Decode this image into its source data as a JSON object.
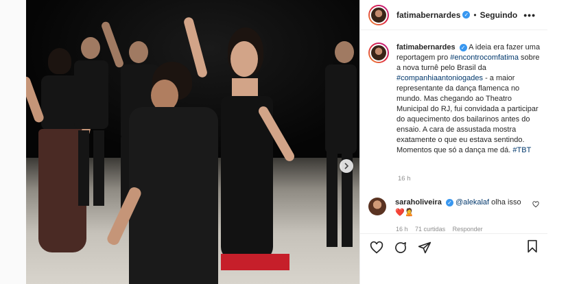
{
  "header": {
    "username": "fatimabernardes",
    "separator": "•",
    "follow_status": "Seguindo",
    "more": "•••"
  },
  "caption": {
    "username": "fatimabernardes",
    "text_part1": "A ideia era fazer uma reportagem pro",
    "hashtag1": "#encontrocomfatima",
    "text_part2": "sobre a nova turnê pelo Brasil da",
    "mention1": "#companhiaantoniogades",
    "text_part3": "- a maior representante da dança flamenca no mundo. Mas chegando ao Theatro Municipal do RJ, fui convidada a participar do aquecimento dos bailarinos antes do ensaio. A cara de assustada mostra exatamente o que eu estava sentindo. Momentos que só a dança me dá.",
    "hashtag2": "#TBT",
    "time": "16 h"
  },
  "comment": {
    "username": "saraholiveira",
    "mention": "@alekalaf",
    "text": "olha isso",
    "emoji": "❤️🙎",
    "time": "16 h",
    "likes": "71 curtidas",
    "reply": "Responder"
  },
  "icons": {
    "like": "heart-icon",
    "comment": "comment-icon",
    "share": "share-icon",
    "save": "bookmark-icon",
    "next": "chevron-right-icon",
    "verified": "verified-badge-icon"
  },
  "colors": {
    "link": "#00376b",
    "verified": "#3897f0",
    "muted": "#8e8e8e"
  }
}
